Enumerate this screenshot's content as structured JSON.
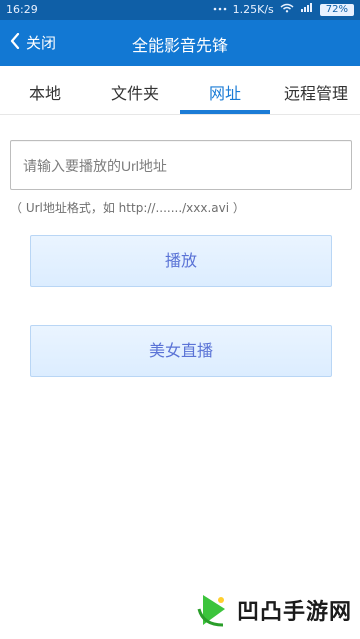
{
  "statusbar": {
    "time": "16:29",
    "speed": "1.25K/s",
    "battery": "72%"
  },
  "header": {
    "back_label": "关闭",
    "title": "全能影音先锋"
  },
  "tabs": [
    {
      "label": "本地"
    },
    {
      "label": "文件夹"
    },
    {
      "label": "网址"
    },
    {
      "label": "远程管理"
    }
  ],
  "url_input": {
    "placeholder": "请输入要播放的Url地址",
    "value": ""
  },
  "hint": "（ Url地址格式，如 http://......./xxx.avi ）",
  "buttons": {
    "play_label": "播放",
    "live_label": "美女直播"
  },
  "watermark": {
    "text": "凹凸手游网"
  },
  "colors": {
    "statusbar_bg": "#0f5fa7",
    "titlebar_bg": "#1278d3",
    "tab_active": "#1b7cd6",
    "button_text": "#5a73d6"
  }
}
